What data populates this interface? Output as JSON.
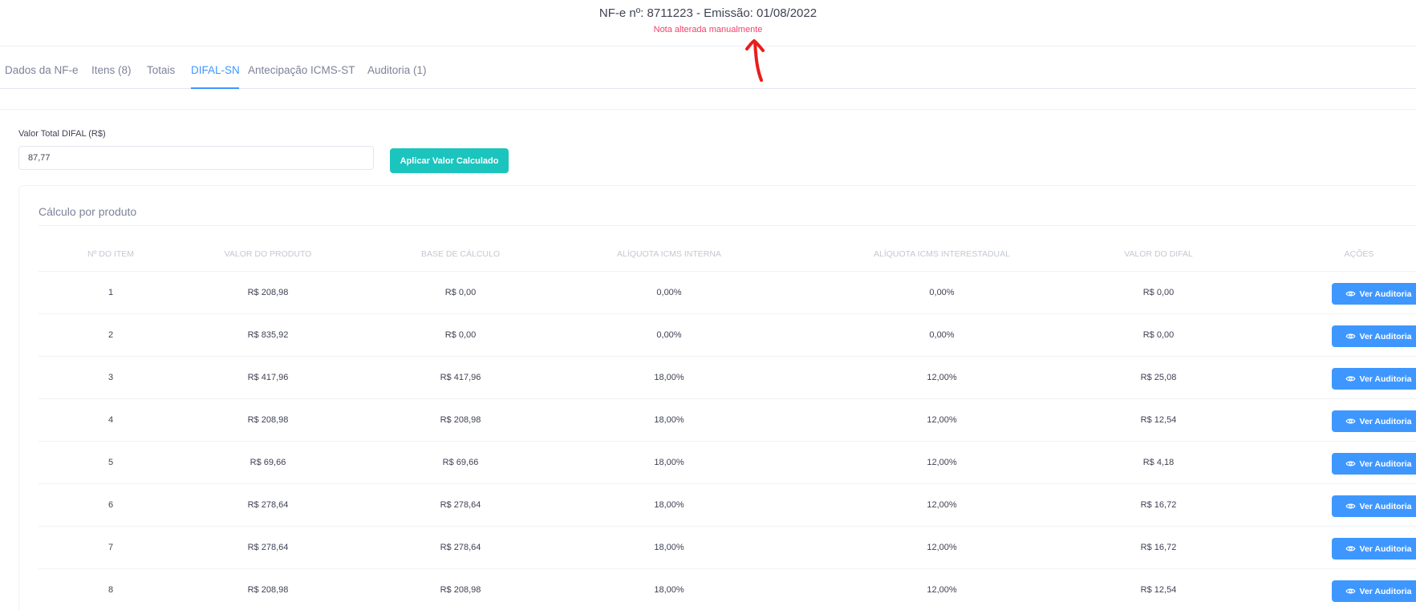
{
  "header": {
    "title": "NF-e nº: 8711223 - Emissão: 01/08/2022",
    "note": "Nota alterada manualmente"
  },
  "tabs": [
    {
      "label": "Dados da NF-e"
    },
    {
      "label": "Itens (8)"
    },
    {
      "label": "Totais"
    },
    {
      "label": "DIFAL-SN",
      "active": true
    },
    {
      "label": "Antecipação ICMS-ST"
    },
    {
      "label": "Auditoria (1)"
    }
  ],
  "difal": {
    "label": "Valor Total DIFAL (R$)",
    "value": "87,77",
    "apply_label": "Aplicar Valor Calculado"
  },
  "card": {
    "title": "Cálculo por produto",
    "columns": [
      "Nº do item",
      "Valor do produto",
      "Base de cálculo",
      "Alíquota ICMS interna",
      "Alíquota ICMS interestadual",
      "Valor do DIFAL",
      "Ações"
    ],
    "action_label": "Ver Auditoria",
    "rows": [
      {
        "item": "1",
        "valor": "R$ 208,98",
        "base": "R$ 0,00",
        "interna": "0,00%",
        "inter": "0,00%",
        "difal": "R$ 0,00"
      },
      {
        "item": "2",
        "valor": "R$ 835,92",
        "base": "R$ 0,00",
        "interna": "0,00%",
        "inter": "0,00%",
        "difal": "R$ 0,00"
      },
      {
        "item": "3",
        "valor": "R$ 417,96",
        "base": "R$ 417,96",
        "interna": "18,00%",
        "inter": "12,00%",
        "difal": "R$ 25,08"
      },
      {
        "item": "4",
        "valor": "R$ 208,98",
        "base": "R$ 208,98",
        "interna": "18,00%",
        "inter": "12,00%",
        "difal": "R$ 12,54"
      },
      {
        "item": "5",
        "valor": "R$ 69,66",
        "base": "R$ 69,66",
        "interna": "18,00%",
        "inter": "12,00%",
        "difal": "R$ 4,18"
      },
      {
        "item": "6",
        "valor": "R$ 278,64",
        "base": "R$ 278,64",
        "interna": "18,00%",
        "inter": "12,00%",
        "difal": "R$ 16,72"
      },
      {
        "item": "7",
        "valor": "R$ 278,64",
        "base": "R$ 278,64",
        "interna": "18,00%",
        "inter": "12,00%",
        "difal": "R$ 16,72"
      },
      {
        "item": "8",
        "valor": "R$ 208,98",
        "base": "R$ 208,98",
        "interna": "18,00%",
        "inter": "12,00%",
        "difal": "R$ 12,54"
      }
    ]
  },
  "colors": {
    "accent": "#3e97ff",
    "apply_button": "#1bc5bd",
    "note": "#f1416c",
    "annotation_arrow": "#e81d1d"
  },
  "icons": [
    "eye-icon",
    "annotation-arrow-icon"
  ]
}
